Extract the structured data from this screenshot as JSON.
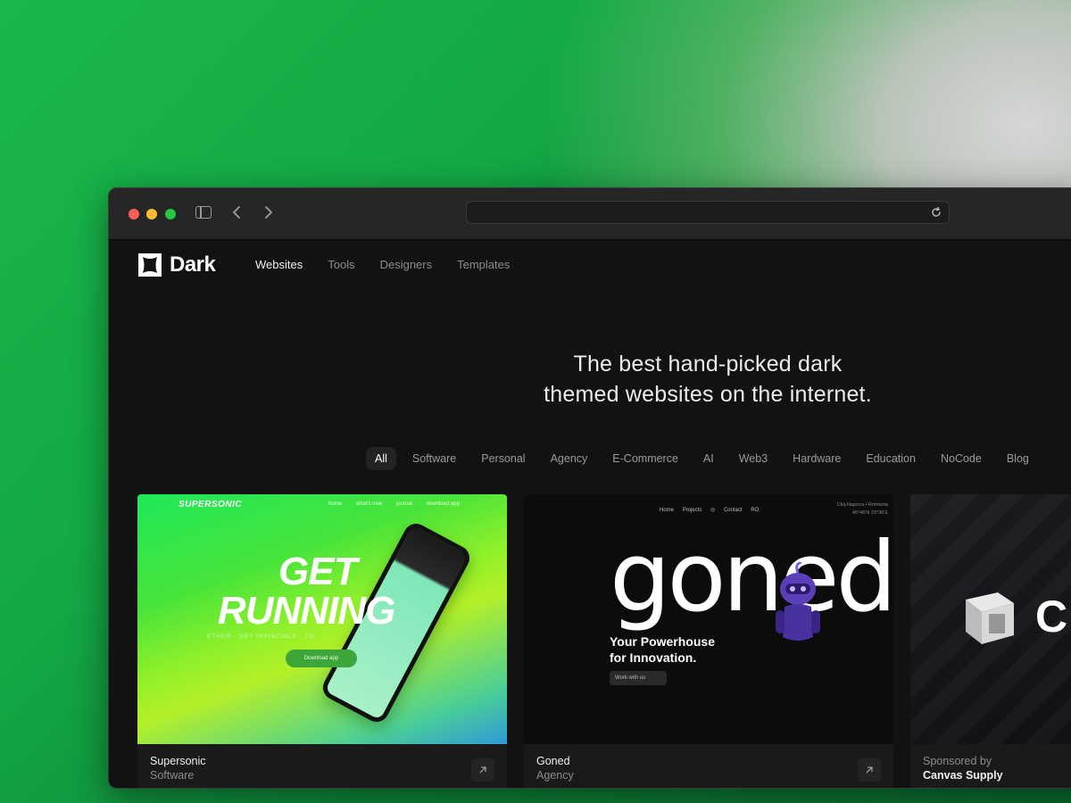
{
  "browser": {
    "address_value": ""
  },
  "site": {
    "brand": "Dark",
    "nav": [
      {
        "label": "Websites",
        "active": true
      },
      {
        "label": "Tools",
        "active": false
      },
      {
        "label": "Designers",
        "active": false
      },
      {
        "label": "Templates",
        "active": false
      }
    ]
  },
  "hero": {
    "line1": "The best hand-picked dark",
    "line2": "themed websites on the internet."
  },
  "filters": [
    "All",
    "Software",
    "Personal",
    "Agency",
    "E-Commerce",
    "AI",
    "Web3",
    "Hardware",
    "Education",
    "NoCode",
    "Blog"
  ],
  "cards": [
    {
      "title": "Supersonic",
      "category": "Software",
      "preview": {
        "brand": "SUPERSONIC",
        "nav": [
          "home",
          "what's new",
          "journal",
          "download app"
        ],
        "headline1": "GET",
        "headline2": "RUNNING",
        "ticker": "ETHER · GET INVINCIBLE · TO",
        "button": "Download app"
      }
    },
    {
      "title": "Goned",
      "category": "Agency",
      "preview": {
        "nav": [
          "Home",
          "Projects",
          "Contact",
          "RO"
        ],
        "meta1": "Cluj-Napoca • Romania",
        "meta2": "46°46'N 23°36'E",
        "word": "goned",
        "tagline1": "Your Powerhouse",
        "tagline2": "for Innovation.",
        "button": "Work with us"
      }
    },
    {
      "sponsored_label": "Sponsored by",
      "title": "Canvas Supply",
      "preview": {
        "letter": "C"
      }
    }
  ],
  "colors": {
    "page_bg": "#121212",
    "titlebar": "#262626",
    "accent_green": "#1fe85a"
  }
}
